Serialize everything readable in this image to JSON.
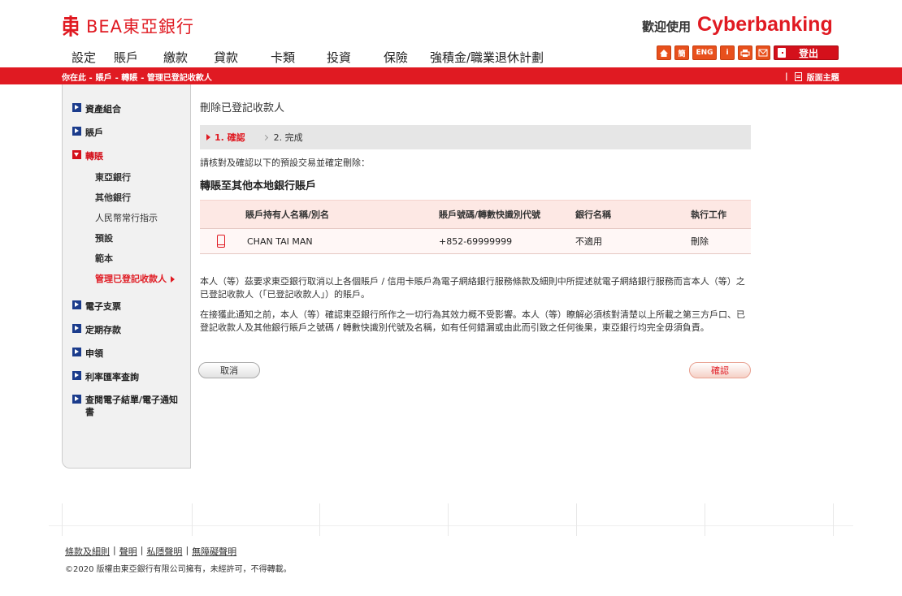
{
  "header": {
    "logo_text": "BEA東亞銀行",
    "welcome_prefix": "歡迎使用",
    "welcome_brand": "Cyberbanking",
    "nav": [
      "設定",
      "賬戶",
      "繳款",
      "貸款",
      "卡類",
      "投資",
      "保險",
      "強積金/職業退休計劃"
    ],
    "tools": {
      "home": "home-icon",
      "simplified": "簡",
      "eng": "ENG",
      "info": "i",
      "print": "print-icon",
      "mail": "mail-icon",
      "logout": "登出"
    }
  },
  "breadcrumb": {
    "prefix": "你在此 -",
    "items": [
      "賬戶",
      "- 轉賬",
      "- 管理已登記收款人"
    ],
    "theme_sep": "|",
    "theme_label": "版面主題"
  },
  "sidebar": {
    "items": [
      {
        "label": "資產組合"
      },
      {
        "label": "賬戶"
      },
      {
        "label": "轉賬"
      },
      {
        "label": "電子支票"
      },
      {
        "label": "定期存款"
      },
      {
        "label": "申領"
      },
      {
        "label": "利率匯率查詢"
      },
      {
        "label": "查閱電子結單/電子通知書"
      }
    ],
    "subitems": [
      "東亞銀行",
      "其他銀行",
      "人民幣常行指示",
      "預設",
      "範本",
      "管理已登記收款人"
    ]
  },
  "main": {
    "title": "刪除已登記收款人",
    "step1": "1. 確認",
    "step2": "2. 完成",
    "instruction": "請核對及確認以下的預設交易並確定刪除：",
    "section_title": "轉賬至其他本地銀行賬戶",
    "table": {
      "headers": [
        "賬戶持有人名稱/別名",
        "賬戶號碼/轉數快識別代號",
        "銀行名稱",
        "執行工作"
      ],
      "row": {
        "icon": "mobile-phone-icon",
        "name": "CHAN TAI MAN",
        "account": "+852-69999999",
        "bank": "不適用",
        "action": "刪除"
      }
    },
    "para1": "本人（等）茲要求東亞銀行取消以上各個賬戶 / 信用卡賬戶為電子網絡銀行服務條款及細則中所提述就電子網絡銀行服務而言本人（等）之已登記收款人（「已登記收款人」）的賬戶。",
    "para2": "在接獲此通知之前，本人（等）確認東亞銀行所作之一切行為其效力概不受影響。本人（等）瞭解必須核對清楚以上所載之第三方戶口、已登記收款人及其他銀行賬戶之號碼 / 轉數快識別代號及名稱，如有任何錯漏或由此而引致之任何後果，東亞銀行均完全毋須負責。",
    "cancel": "取消",
    "confirm": "確認"
  },
  "footer": {
    "links": [
      "條款及細則",
      "聲明",
      "私隱聲明",
      "無障礙聲明"
    ],
    "sep": "|",
    "copyright": "©2020 版權由東亞銀行有限公司擁有，未經許可，不得轉載。"
  },
  "colors": {
    "brand_red": "#e01a22",
    "nav_blue": "#1b3c8c",
    "table_header": "#fde8e4"
  }
}
